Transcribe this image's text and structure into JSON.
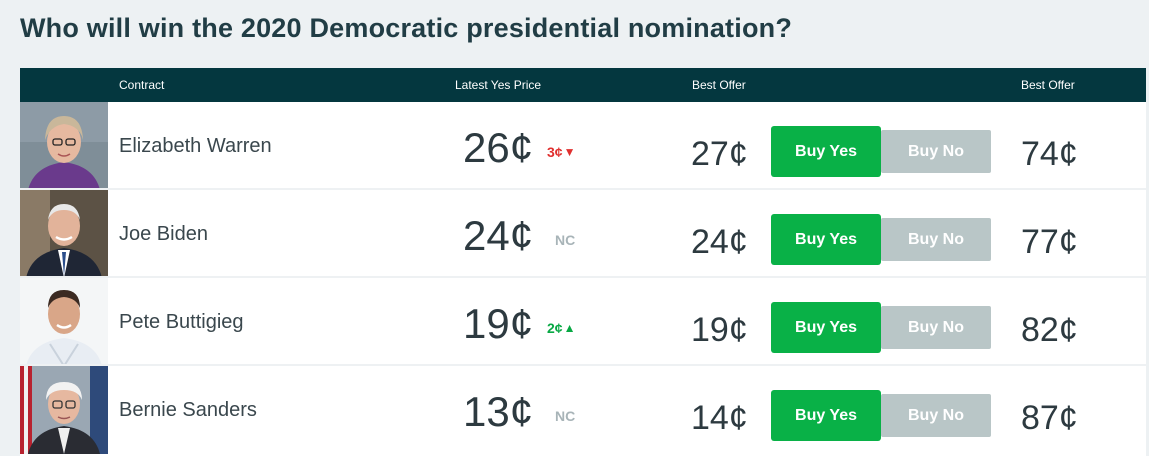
{
  "page": {
    "title": "Who will win the 2020 Democratic presidential nomination?"
  },
  "table": {
    "headers": {
      "contract": "Contract",
      "latest_yes_price": "Latest Yes Price",
      "best_offer_yes": "Best Offer",
      "best_offer_no": "Best Offer"
    },
    "rows": [
      {
        "name": "Elizabeth Warren",
        "latest_price": "26¢",
        "change": "3¢",
        "change_direction": "down",
        "best_offer_yes": "27¢",
        "buy_yes_label": "Buy Yes",
        "buy_no_label": "Buy No",
        "best_offer_no": "74¢"
      },
      {
        "name": "Joe Biden",
        "latest_price": "24¢",
        "change": "NC",
        "change_direction": "none",
        "best_offer_yes": "24¢",
        "buy_yes_label": "Buy Yes",
        "buy_no_label": "Buy No",
        "best_offer_no": "77¢"
      },
      {
        "name": "Pete Buttigieg",
        "latest_price": "19¢",
        "change": "2¢",
        "change_direction": "up",
        "best_offer_yes": "19¢",
        "buy_yes_label": "Buy Yes",
        "buy_no_label": "Buy No",
        "best_offer_no": "82¢"
      },
      {
        "name": "Bernie Sanders",
        "latest_price": "13¢",
        "change": "NC",
        "change_direction": "none",
        "best_offer_yes": "14¢",
        "buy_yes_label": "Buy Yes",
        "buy_no_label": "Buy No",
        "best_offer_no": "87¢"
      }
    ]
  },
  "icons": {
    "down": "arrow-down-icon",
    "up": "arrow-up-icon"
  },
  "colors": {
    "header_bg": "#04373f",
    "buy_yes": "#09b147",
    "buy_no": "#b9c6c7",
    "change_down": "#e0302f",
    "change_up": "#08a844",
    "change_nc": "#a8b4b8"
  }
}
